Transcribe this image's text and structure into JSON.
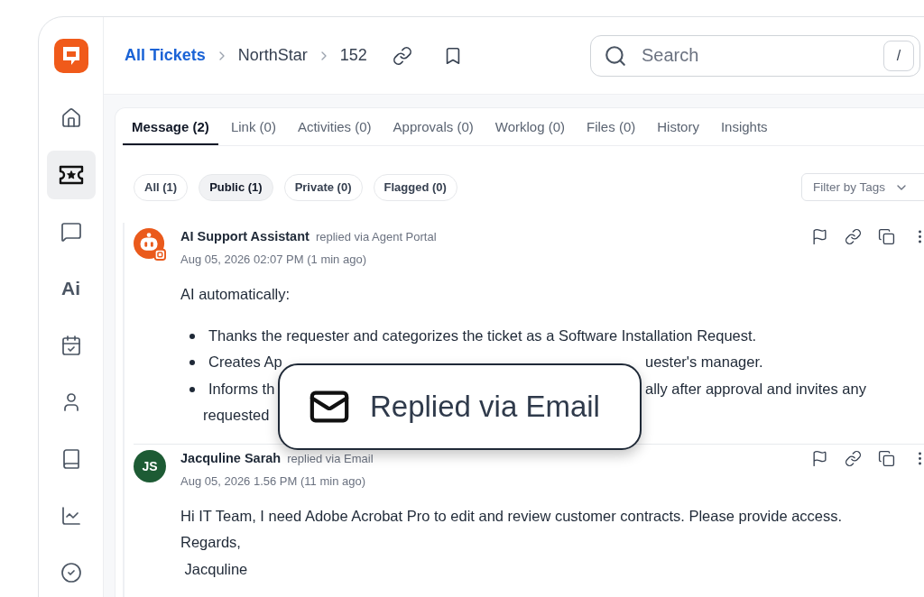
{
  "sidebar": {
    "items": [
      {
        "kind": "home",
        "selected": false
      },
      {
        "kind": "tickets",
        "selected": true
      },
      {
        "kind": "chat",
        "selected": false
      },
      {
        "kind": "ai",
        "label": "Ai",
        "selected": false
      },
      {
        "kind": "tasks",
        "selected": false
      },
      {
        "kind": "people",
        "selected": false
      },
      {
        "kind": "book",
        "selected": false
      },
      {
        "kind": "reports",
        "selected": false
      },
      {
        "kind": "approvals",
        "selected": false
      }
    ]
  },
  "breadcrumb": [
    "All Tickets",
    "NorthStar",
    "152"
  ],
  "search": {
    "placeholder": "Search",
    "shortcut": "/"
  },
  "tabs": [
    {
      "label": "Message (2)",
      "selected": true
    },
    {
      "label": "Link (0)",
      "selected": false
    },
    {
      "label": "Activities (0)",
      "selected": false
    },
    {
      "label": "Approvals (0)",
      "selected": false
    },
    {
      "label": "Worklog (0)",
      "selected": false
    },
    {
      "label": "Files (0)",
      "selected": false
    },
    {
      "label": "History",
      "selected": false
    },
    {
      "label": "Insights",
      "selected": false
    }
  ],
  "filters": [
    {
      "label": "All (1)",
      "selected": false
    },
    {
      "label": "Public (1)",
      "selected": true
    },
    {
      "label": "Private (0)",
      "selected": false
    },
    {
      "label": "Flagged (0)",
      "selected": false
    }
  ],
  "tag_filter": {
    "placeholder": "Filter by Tags"
  },
  "messages": [
    {
      "author": "AI Support Assistant",
      "via": "replied via Agent Portal",
      "time": "Aug 05, 2026 02:07 PM (1 min ago)",
      "avatar": {
        "kind": "bot",
        "color": "#ea5a1c"
      },
      "intro": "AI automatically:",
      "bullets": [
        {
          "segments": [
            "Thanks the requester and categorizes the ticket as a Software Installation Request."
          ]
        },
        {
          "segments": [
            "Creates Ap",
            "uester's manager."
          ]
        },
        {
          "segments": [
            "Informs th",
            "ally after approval and invites any"
          ],
          "continuation": "requested"
        }
      ]
    },
    {
      "author": "Jacquline Sarah",
      "via": "replied via Email",
      "time": "Aug 05, 2026 1.56 PM (11 min ago)",
      "avatar": {
        "kind": "initials",
        "initials": "JS",
        "color": "#1d5b34"
      },
      "lines": [
        "Hi IT Team, I need Adobe Acrobat Pro to edit and review customer contracts. Please provide access.",
        "Regards,",
        " Jacquline"
      ]
    }
  ],
  "toast": {
    "label": "Replied via Email"
  }
}
